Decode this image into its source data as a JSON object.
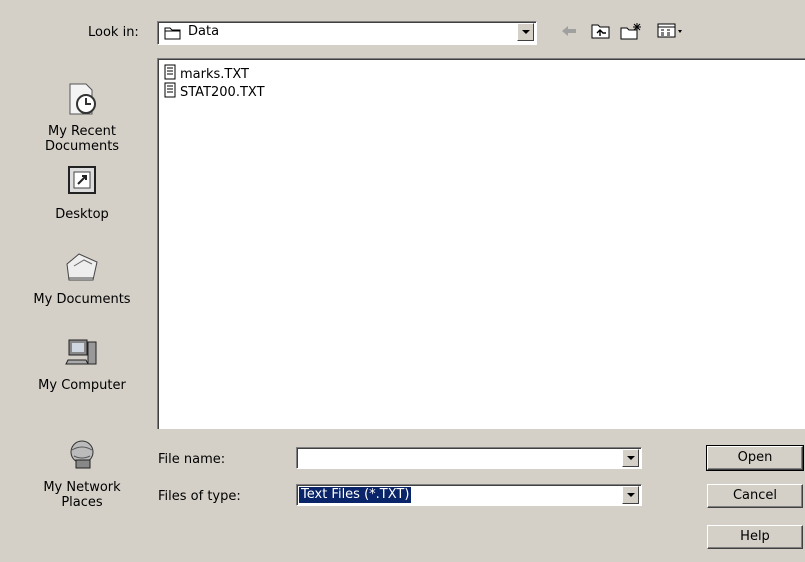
{
  "look_in": {
    "label": "Look in:",
    "value": "Data"
  },
  "toolbar": {
    "back_icon": "back-arrow-icon",
    "up_icon": "up-one-level-icon",
    "new_folder_icon": "new-folder-icon",
    "views_icon": "views-menu-icon"
  },
  "places": [
    {
      "label": "My Recent Documents",
      "icon": "recent-documents-icon"
    },
    {
      "label": "Desktop",
      "icon": "desktop-icon"
    },
    {
      "label": "My Documents",
      "icon": "my-documents-icon"
    },
    {
      "label": "My Computer",
      "icon": "my-computer-icon"
    },
    {
      "label": "My Network Places",
      "icon": "network-places-icon"
    }
  ],
  "files": [
    {
      "name": "marks.TXT",
      "icon": "text-file-icon"
    },
    {
      "name": "STAT200.TXT",
      "icon": "text-file-icon"
    }
  ],
  "file_name": {
    "label": "File name:",
    "value": ""
  },
  "file_type": {
    "label": "Files of type:",
    "value": "Text Files (*.TXT)"
  },
  "buttons": {
    "open": "Open",
    "cancel": "Cancel",
    "help": "Help"
  },
  "colors": {
    "dialog_bg": "#d4d0c8",
    "selection": "#0a246a"
  }
}
